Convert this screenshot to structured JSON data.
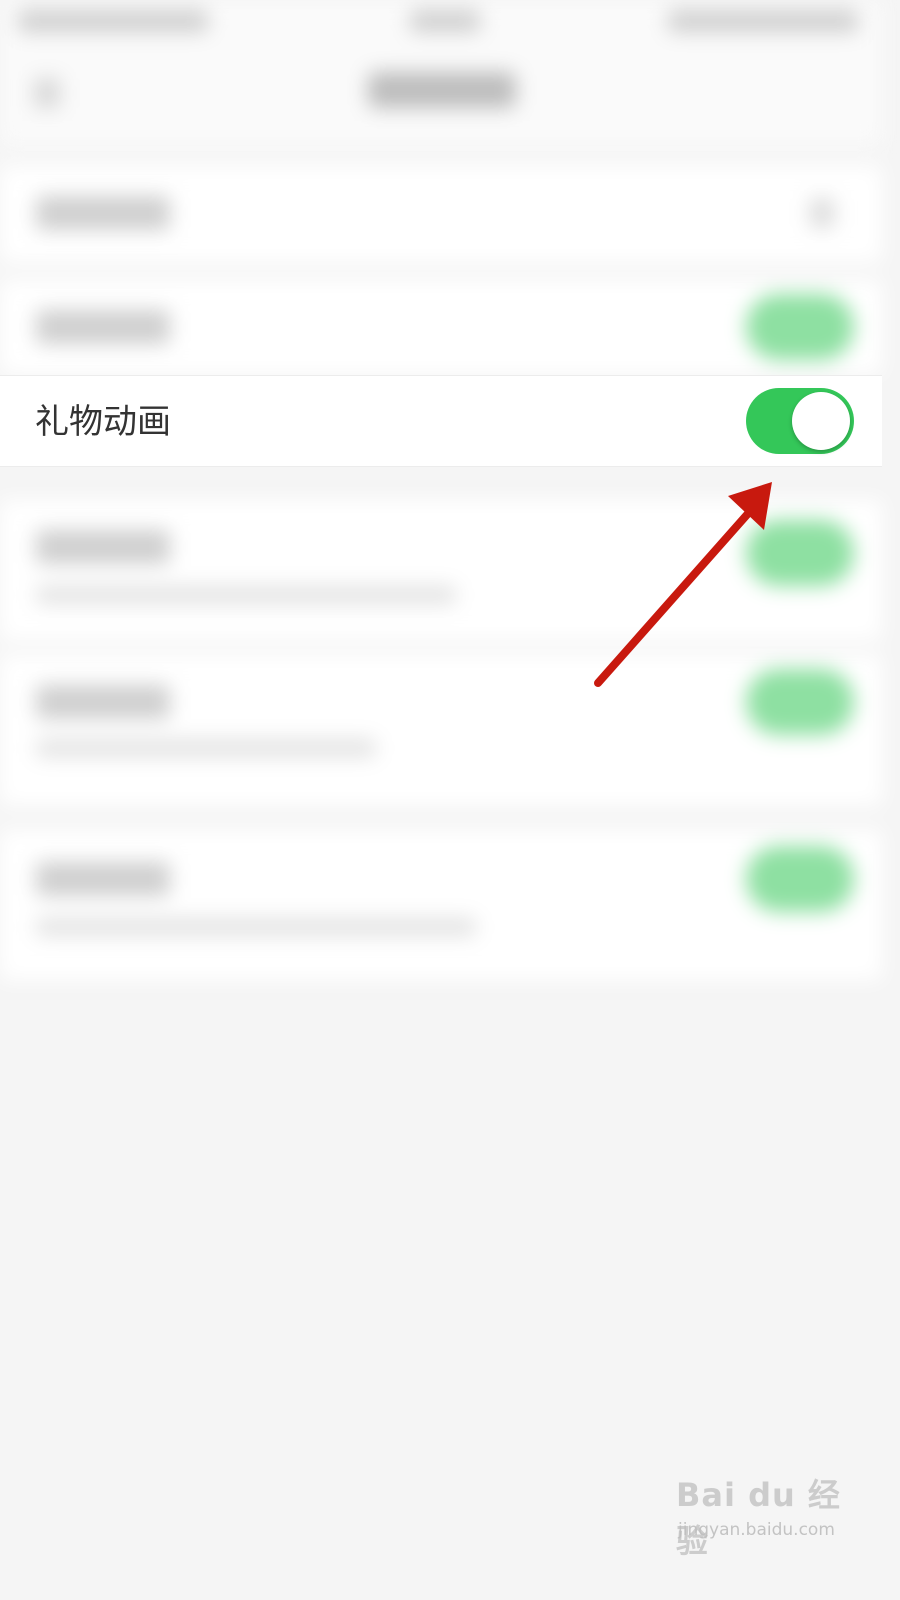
{
  "settings": {
    "gift_animation": {
      "label": "礼物动画",
      "toggle_on": true
    }
  },
  "watermark": {
    "logo_text": "Bai du 经验",
    "url": "jingyan.baidu.com"
  },
  "colors": {
    "toggle_on": "#34c759",
    "arrow": "#c8190e",
    "background": "#f5f5f5"
  }
}
